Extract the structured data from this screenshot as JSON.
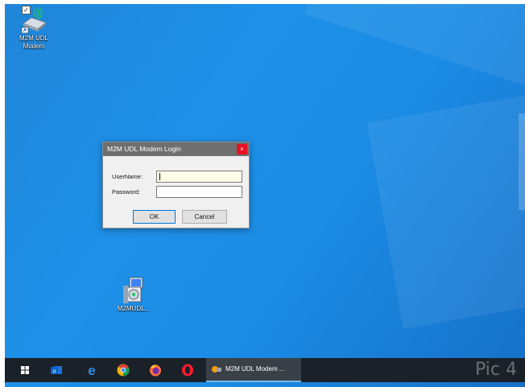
{
  "desktop": {
    "icons": [
      {
        "label_line1": "M2M UDL",
        "label_line2": "Modem",
        "checked": "✓"
      },
      {
        "label_line1": "M2MUDL...",
        "label_line2": ""
      }
    ]
  },
  "dialog": {
    "title": "M2M UDL Modem Login",
    "close_glyph": "×",
    "username_label": "UserName:",
    "password_label": "Password:",
    "username_value": "",
    "password_value": "",
    "ok_label": "OK",
    "cancel_label": "Cancel"
  },
  "taskbar": {
    "running_app_label": "M2M UDL Modem ...",
    "icons": [
      "windows-start-icon",
      "outlook-icon",
      "edge-icon",
      "chrome-icon",
      "firefox-icon",
      "opera-icon"
    ]
  },
  "watermark": "Pic 4",
  "colors": {
    "desktop": "#1e90e8",
    "taskbar": "#1b2129",
    "close_button": "#e81123",
    "username_field_bg": "#fffde8"
  }
}
